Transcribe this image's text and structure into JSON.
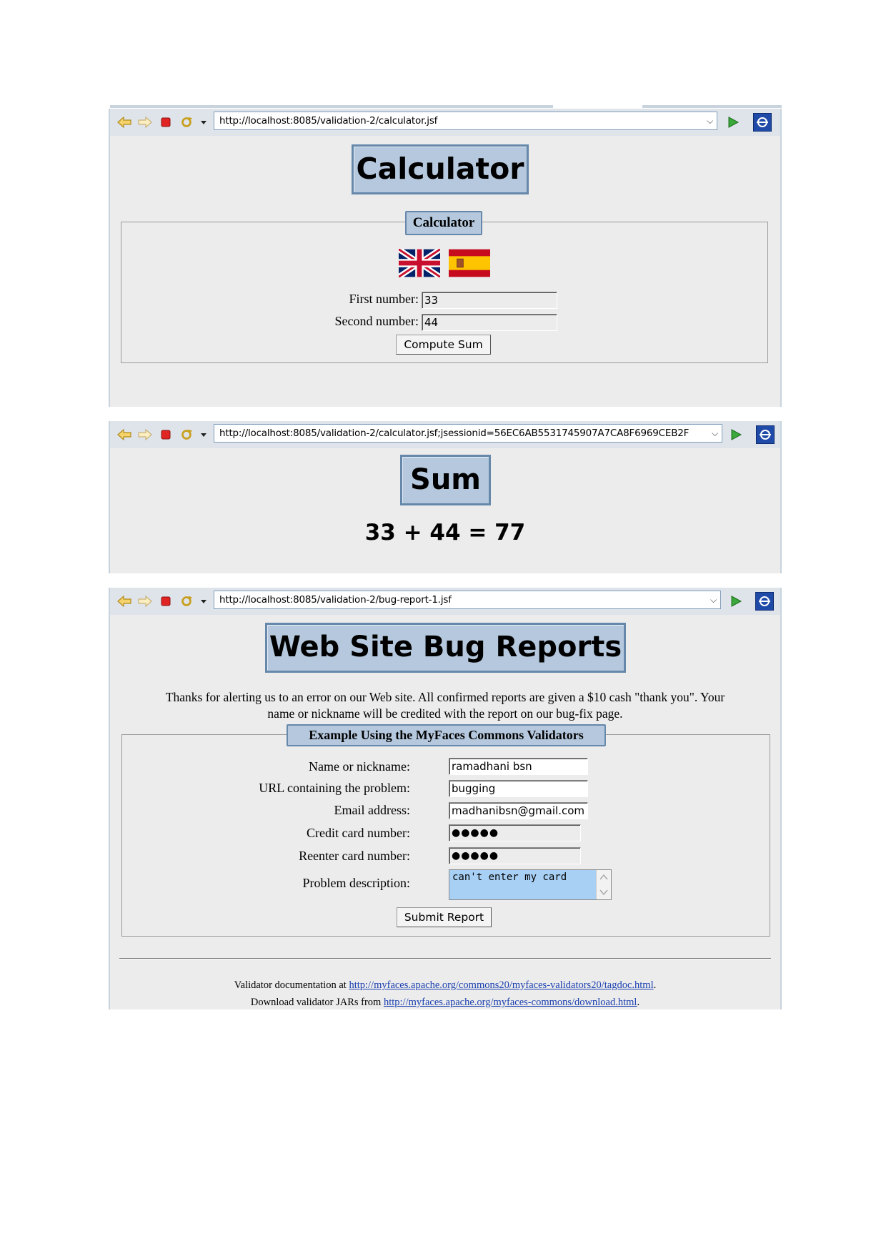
{
  "calculator_window": {
    "url": "http://localhost:8085/validation-2/calculator.jsf",
    "title": "Calculator",
    "legend": "Calculator",
    "flags": [
      "uk-flag-icon",
      "spain-flag-icon"
    ],
    "first_label": "First number:",
    "first_value": "33",
    "second_label": "Second number:",
    "second_value": "44",
    "button": "Compute Sum"
  },
  "sum_window": {
    "url": "http://localhost:8085/validation-2/calculator.jsf;jsessionid=56EC6AB5531745907A7CA8F6969CEB2F",
    "title": "Sum",
    "result": "33 + 44 = 77"
  },
  "bug_window": {
    "url": "http://localhost:8085/validation-2/bug-report-1.jsf",
    "title": "Web Site Bug Reports",
    "intro_line1": "Thanks for alerting us to an error on our Web site. All confirmed reports are given a $10 cash \"thank you\". Your",
    "intro_line2": "name or nickname will be credited with the report on our bug-fix page.",
    "legend": "Example Using the MyFaces Commons Validators",
    "fields": [
      {
        "label": "Name or nickname:",
        "value": "ramadhani bsn"
      },
      {
        "label": "URL containing the problem:",
        "value": "bugging"
      },
      {
        "label": "Email address:",
        "value": "madhanibsn@gmail.com"
      },
      {
        "label": "Credit card number:",
        "value": "●●●●●"
      },
      {
        "label": "Reenter card number:",
        "value": "●●●●●"
      }
    ],
    "problem_label": "Problem description:",
    "problem_value": "can't enter my card",
    "button": "Submit Report",
    "footer1_prefix": "Validator documentation at ",
    "footer1_link": "http://myfaces.apache.org/commons20/myfaces-validators20/tagdoc.html",
    "footer1_suffix": ".",
    "footer2_prefix": "Download validator JARs from ",
    "footer2_link": "http://myfaces.apache.org/myfaces-commons/download.html",
    "footer2_suffix": "."
  },
  "colors": {
    "title_bg": "#b5c8dd",
    "title_border": "#6688aa",
    "page_bg": "#ececec",
    "textarea_bg": "#a8d0f5",
    "link": "#1a3fb0"
  }
}
